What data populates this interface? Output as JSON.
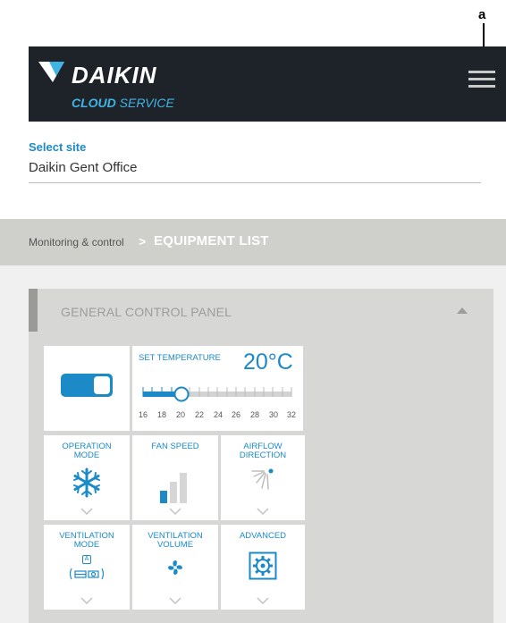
{
  "callout": {
    "label": "a"
  },
  "header": {
    "brand": "DAIKIN",
    "subtitle_bold": "CLOUD",
    "subtitle_light": "SERVICE",
    "icons": {
      "menu": "hamburger-menu-icon",
      "logo": "daikin-logo-icon"
    }
  },
  "site": {
    "label": "Select site",
    "value": "Daikin Gent Office"
  },
  "breadcrumb": {
    "parent": "Monitoring & control",
    "separator": ">",
    "current": "EQUIPMENT LIST"
  },
  "panel": {
    "title": "GENERAL CONTROL PANEL",
    "power": {
      "on": true
    },
    "set_temperature": {
      "label": "SET TEMPERATURE",
      "value": "20°C",
      "scale": [
        "16",
        "18",
        "20",
        "22",
        "24",
        "26",
        "28",
        "30",
        "32"
      ],
      "min": 16,
      "max": 32,
      "current": 20
    },
    "operation_mode": {
      "label_1": "OPERATION",
      "label_2": "MODE",
      "icon": "snowflake-icon"
    },
    "fan_speed": {
      "label_1": "FAN SPEED",
      "level": 1,
      "levels": 3
    },
    "airflow_direction": {
      "label_1": "AIRFLOW",
      "label_2": "DIRECTION",
      "icon": "airflow-icon"
    },
    "ventilation_mode": {
      "label_1": "VENTILATION",
      "label_2": "MODE",
      "icon_glyph_top": "A",
      "icon": "ventilation-mode-icon"
    },
    "ventilation_volume": {
      "label_1": "VENTILATION",
      "label_2": "VOLUME",
      "icon": "fan-icon"
    },
    "advanced": {
      "label_1": "ADVANCED",
      "icon": "gear-icon"
    }
  },
  "colors": {
    "accent": "#1c8ac7",
    "header_bg": "#1e232a",
    "panel_bg": "#d7d7d5"
  }
}
